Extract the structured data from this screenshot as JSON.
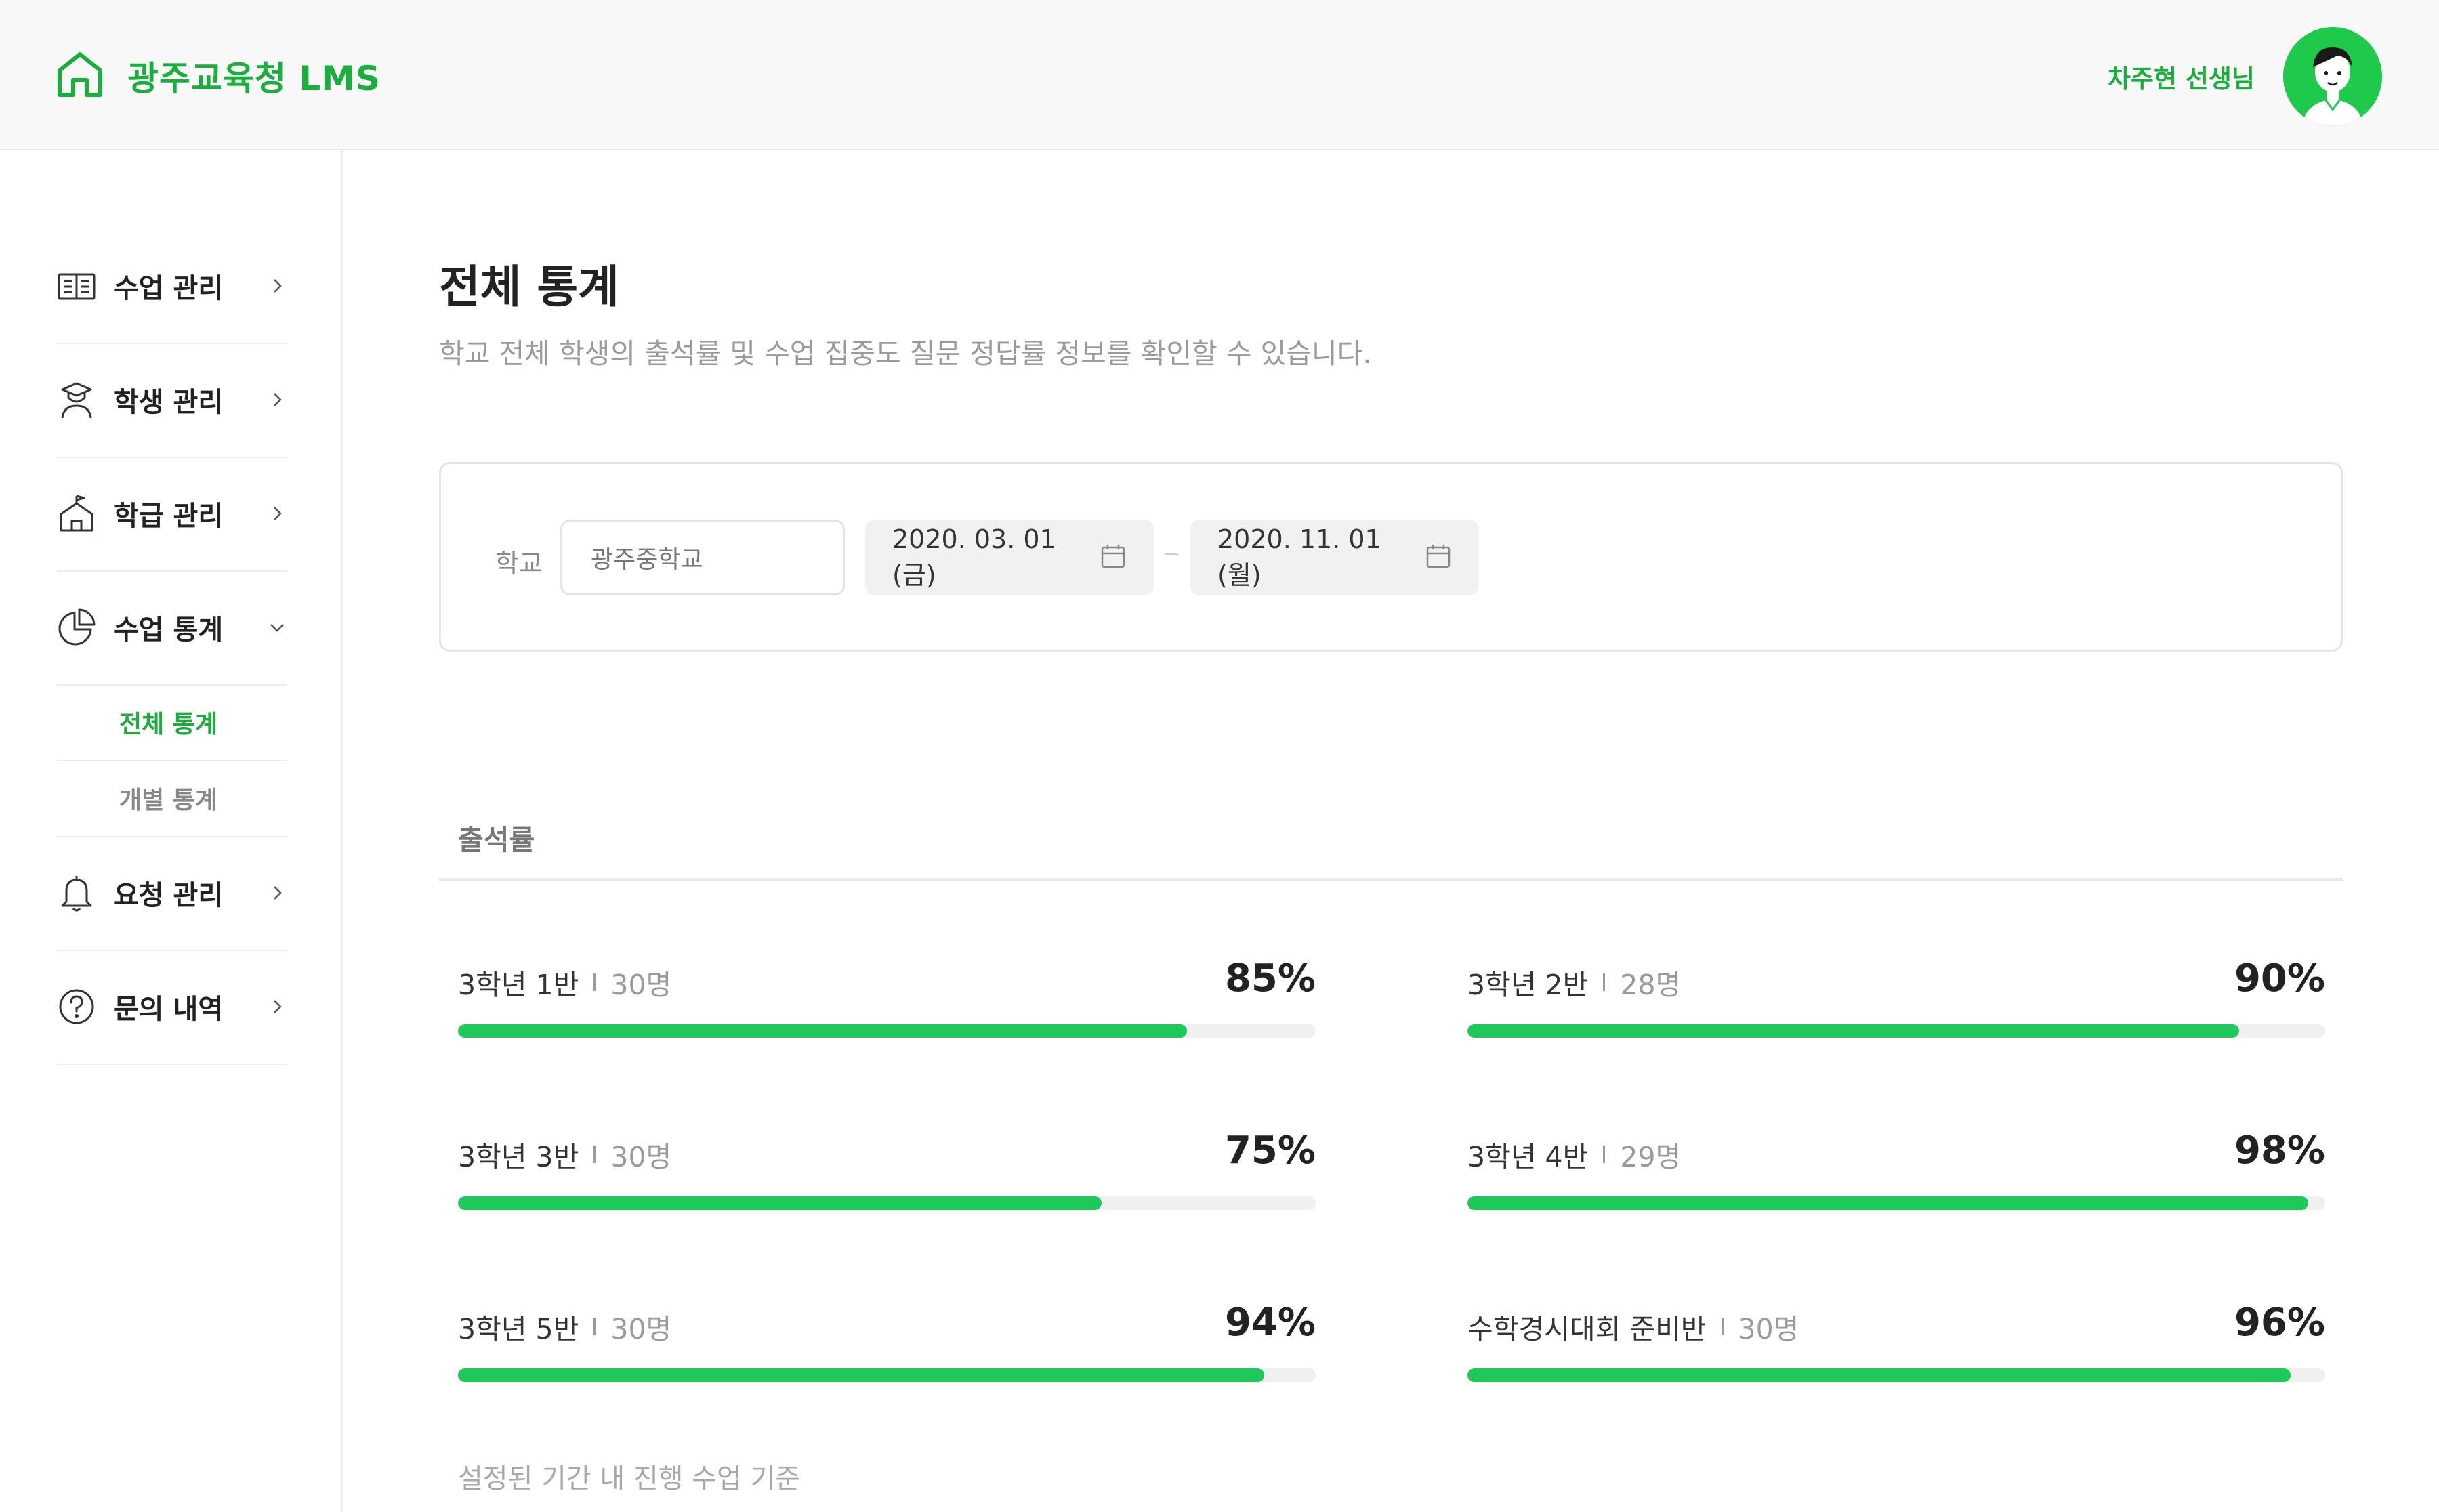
{
  "header": {
    "title": "광주교육청 LMS",
    "user_name": "차주현 선생님",
    "accent": "#1aae3d"
  },
  "sidebar": {
    "items": [
      {
        "label": "수업 관리",
        "icon": "book-icon",
        "expanded": false
      },
      {
        "label": "학생 관리",
        "icon": "student-icon",
        "expanded": false
      },
      {
        "label": "학급 관리",
        "icon": "school-icon",
        "expanded": false
      },
      {
        "label": "수업 통계",
        "icon": "pie-chart-icon",
        "expanded": true
      },
      {
        "label": "요청 관리",
        "icon": "bell-icon",
        "expanded": false
      },
      {
        "label": "문의 내역",
        "icon": "question-icon",
        "expanded": false
      }
    ],
    "sub_items": [
      {
        "label": "전체 통계",
        "active": true
      },
      {
        "label": "개별 통계",
        "active": false
      }
    ]
  },
  "main": {
    "title": "전체 통계",
    "description": "학교 전체 학생의 출석률 및 수업 집중도 질문 정답률 정보를 확인할 수 있습니다.",
    "filter": {
      "school_label": "학교",
      "school_value": "광주중학교",
      "date_start": "2020. 03. 01 (금)",
      "date_end": "2020. 11. 01 (월)",
      "date_separator": "-"
    },
    "section_title": "출석률",
    "stats": [
      {
        "name": "3학년 1반",
        "count": "30명",
        "percent_label": "85%",
        "percent": 85
      },
      {
        "name": "3학년 2반",
        "count": "28명",
        "percent_label": "90%",
        "percent": 90
      },
      {
        "name": "3학년 3반",
        "count": "30명",
        "percent_label": "75%",
        "percent": 75
      },
      {
        "name": "3학년 4반",
        "count": "29명",
        "percent_label": "98%",
        "percent": 98
      },
      {
        "name": "3학년 5반",
        "count": "30명",
        "percent_label": "94%",
        "percent": 94
      },
      {
        "name": "수학경시대회 준비반",
        "count": "30명",
        "percent_label": "96%",
        "percent": 96
      }
    ],
    "footnote": "설정된 기간 내 진행 수업 기준"
  }
}
